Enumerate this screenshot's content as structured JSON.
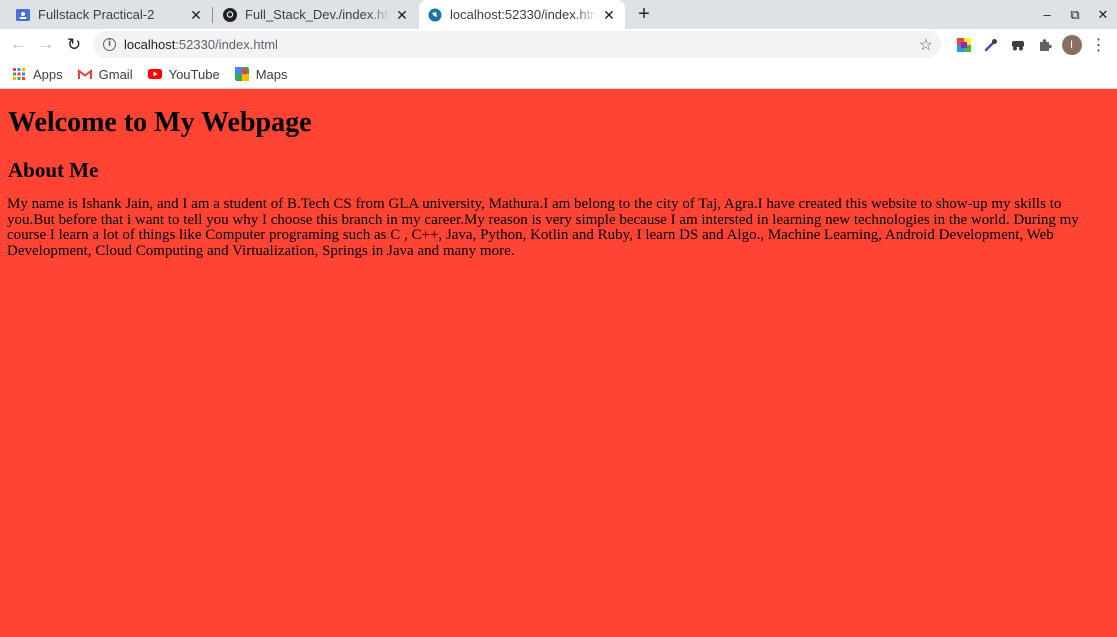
{
  "tabs": [
    {
      "title": "Fullstack Practical-2",
      "close": "✕"
    },
    {
      "title": "Full_Stack_Dev./index.html",
      "close": "✕"
    },
    {
      "title": "localhost:52330/index.html",
      "close": "✕"
    }
  ],
  "new_tab": "+",
  "window_controls": {
    "minimize": "–",
    "restore": "⧉",
    "close": "✕"
  },
  "toolbar": {
    "back": "←",
    "forward": "→",
    "reload": "↻",
    "url_host": "localhost",
    "url_rest": ":52330/index.html",
    "info": "i",
    "star": "☆",
    "avatar_letter": "I"
  },
  "bookmarks": [
    {
      "label": "Apps",
      "icon": "apps-grid-icon"
    },
    {
      "label": "Gmail",
      "icon": "gmail-icon"
    },
    {
      "label": "YouTube",
      "icon": "youtube-icon"
    },
    {
      "label": "Maps",
      "icon": "maps-icon"
    }
  ],
  "page": {
    "heading": "Welcome to My Webpage",
    "subheading": "About Me",
    "paragraph": "My name is Ishank Jain, and I am a student of B.Tech CS from GLA university, Mathura.I am belong to the city of Taj, Agra.I have created this website to show-up my skills to you.But before that i want to tell you why I choose this branch in my career.My reason is very simple because I am intersted in learning new technologies in the world. During my course I learn a lot of things like Computer programing such as C , C++, Java, Python, Kotlin and Ruby, I learn DS and Algo., Machine Learning, Android Development, Web Development, Cloud Computing and Virtualization, Springs in Java and many more."
  },
  "colors": {
    "page_background": "#ff4433",
    "tabstrip": "#dee1e6"
  }
}
